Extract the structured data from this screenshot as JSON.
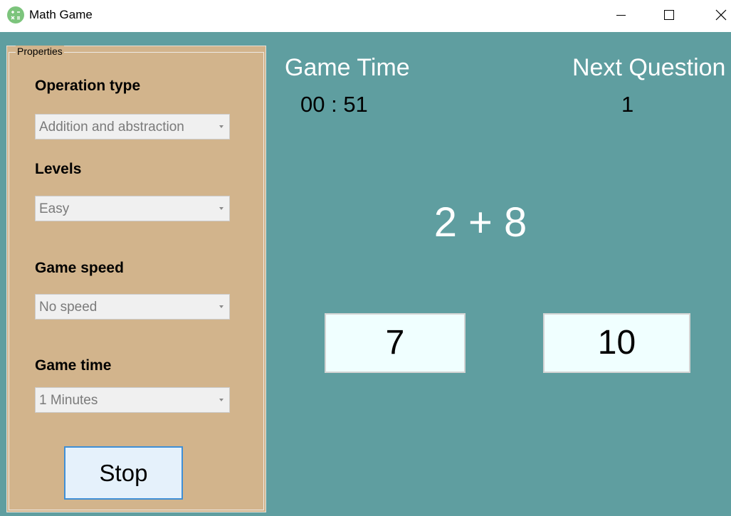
{
  "window": {
    "title": "Math Game",
    "icon": "calculator-icon",
    "controls": [
      "minimize-icon",
      "maximize-icon",
      "close-icon"
    ]
  },
  "properties": {
    "caption": "Properties",
    "operation_type": {
      "label": "Operation type",
      "value": "Addition and abstraction"
    },
    "levels": {
      "label": "Levels",
      "value": "Easy"
    },
    "game_speed": {
      "label": "Game speed",
      "value": "No speed"
    },
    "game_time": {
      "label": "Game time",
      "value": "1 Minutes"
    },
    "stop_label": "Stop"
  },
  "game": {
    "game_time_label": "Game Time",
    "game_time_value": "00 : 51",
    "next_question_label": "Next Question",
    "next_question_value": "1",
    "question": "2 + 8",
    "answers": [
      "7",
      "10"
    ]
  },
  "colors": {
    "background": "#5f9ea0",
    "panel": "#d2b48c",
    "answer_box": "#f0ffff",
    "stop_border": "#3f8fd6"
  }
}
